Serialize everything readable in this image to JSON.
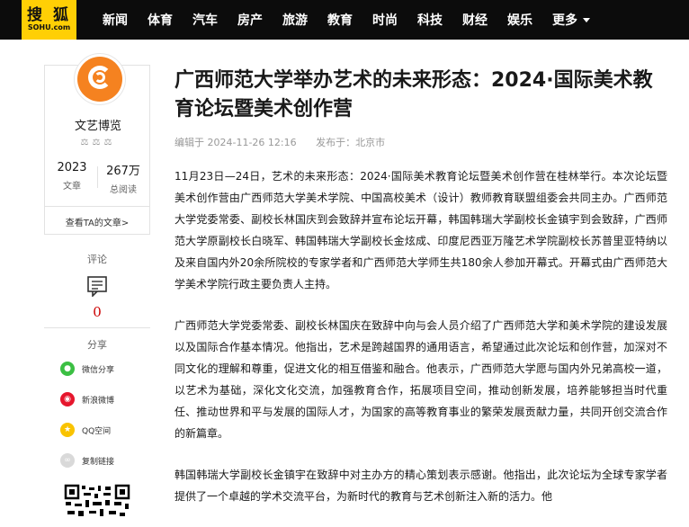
{
  "logo": {
    "cn": "搜 狐",
    "en": "SOHU.com"
  },
  "nav": {
    "items": [
      "新闻",
      "体育",
      "汽车",
      "房产",
      "旅游",
      "教育",
      "时尚",
      "科技",
      "财经",
      "娱乐"
    ],
    "more": "更多"
  },
  "author": {
    "name": "文艺博览",
    "badges": "⚖⚖⚖",
    "articles_count": "2023",
    "articles_label": "文章",
    "views_count": "267万",
    "views_label": "总阅读",
    "view_link": "查看TA的文章>"
  },
  "comments": {
    "label": "评论",
    "count": "0"
  },
  "share": {
    "label": "分享",
    "items": [
      {
        "label": "微信分享",
        "icon": "wechat-icon"
      },
      {
        "label": "新浪微博",
        "icon": "weibo-icon"
      },
      {
        "label": "QQ空间",
        "icon": "qzone-icon"
      },
      {
        "label": "复制链接",
        "icon": "link-icon"
      }
    ]
  },
  "article": {
    "title": "广西师范大学举办艺术的未来形态：2024·国际美术教育论坛暨美术创作营",
    "editor": "编辑于 2024-11-26 12:16",
    "location": "发布于：北京市",
    "paragraphs": [
      "11月23日—24日，艺术的未来形态：2024·国际美术教育论坛暨美术创作营在桂林举行。本次论坛暨美术创作营由广西师范大学美术学院、中国高校美术（设计）教师教育联盟组委会共同主办。广西师范大学党委常委、副校长林国庆到会致辞并宣布论坛开幕，韩国韩瑞大学副校长金镇宇到会致辞，广西师范大学原副校长白晓军、韩国韩瑞大学副校长金炫成、印度尼西亚万隆艺术学院副校长苏普里亚特纳以及来自国内外20余所院校的专家学者和广西师范大学师生共180余人参加开幕式。开幕式由广西师范大学美术学院行政主要负责人主持。",
      "广西师范大学党委常委、副校长林国庆在致辞中向与会人员介绍了广西师范大学和美术学院的建设发展以及国际合作基本情况。他指出，艺术是跨越国界的通用语言，希望通过此次论坛和创作营，加深对不同文化的理解和尊重，促进文化的相互借鉴和融合。他表示，广西师范大学愿与国内外兄弟高校一道，以艺术为基础，深化文化交流，加强教育合作，拓展项目空间，推动创新发展，培养能够担当时代重任、推动世界和平与发展的国际人才，为国家的高等教育事业的繁荣发展贡献力量，共同开创交流合作的新篇章。",
      "韩国韩瑞大学副校长金镇宇在致辞中对主办方的精心策划表示感谢。他指出，此次论坛为全球专家学者提供了一个卓越的学术交流平台，为新时代的教育与艺术创新注入新的活力。他"
    ]
  }
}
